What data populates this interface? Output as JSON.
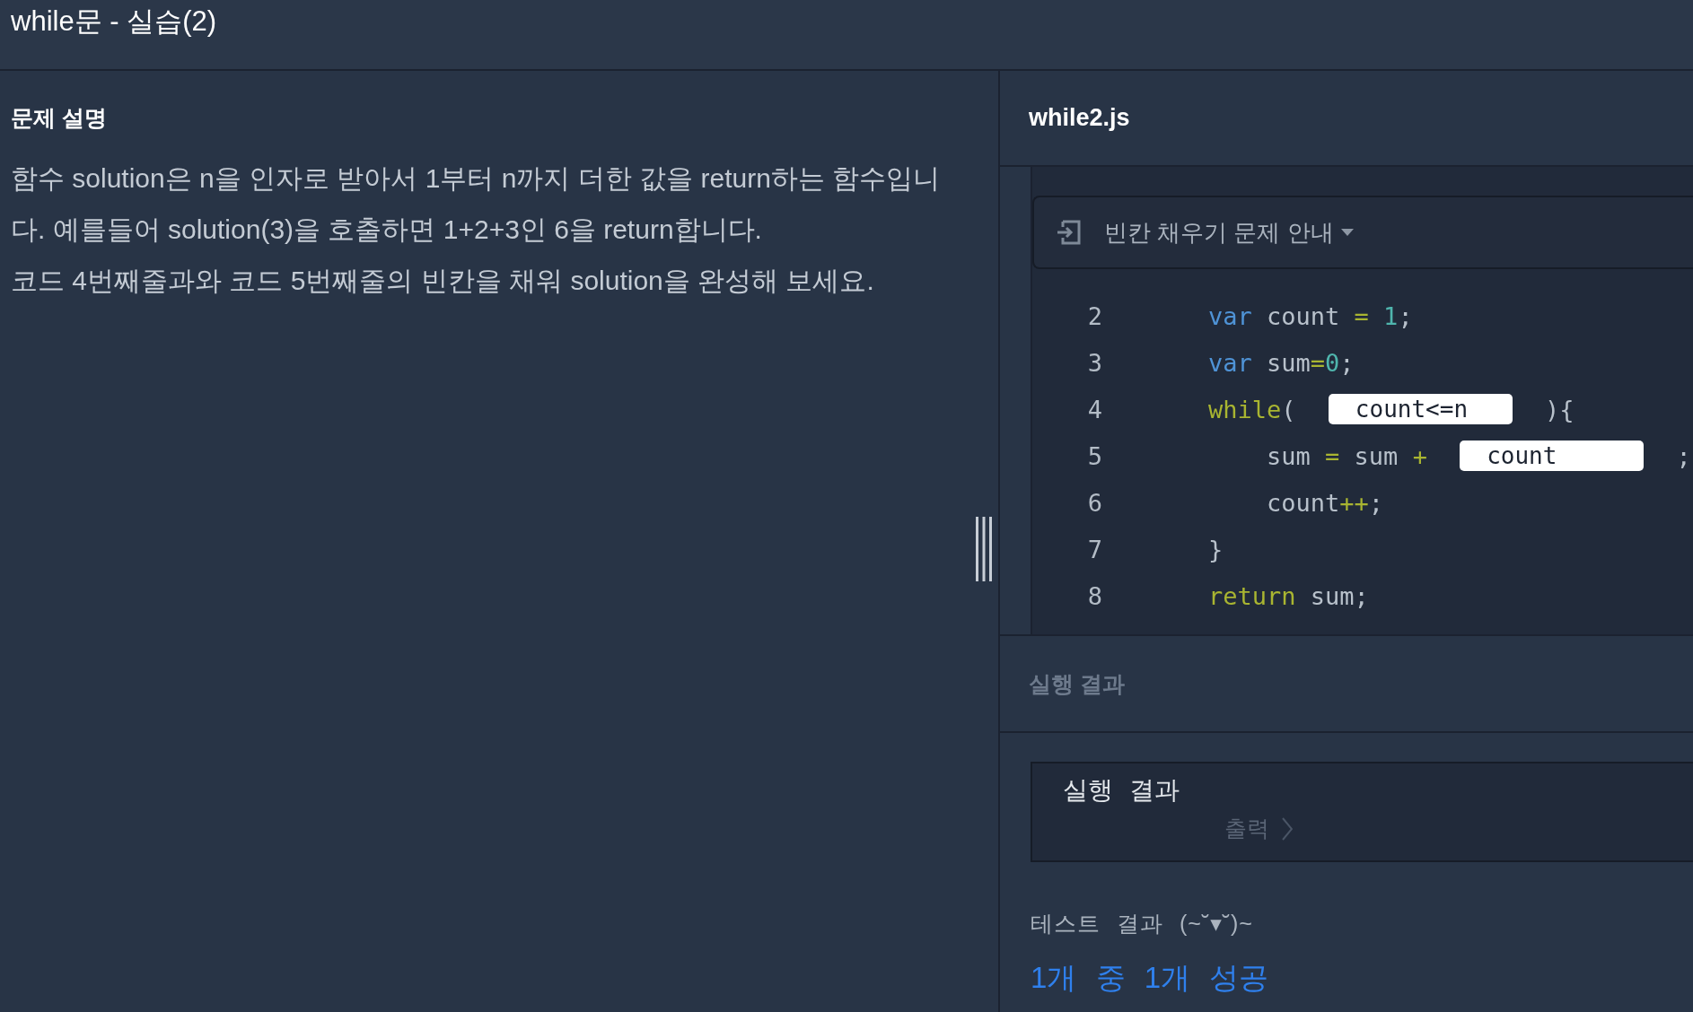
{
  "title": "while문 - 실습(2)",
  "problem": {
    "heading": "문제 설명",
    "paragraphs": [
      "함수 solution은 n을 인자로 받아서 1부터 n까지 더한 값을 return하는 함수입니다. 예를들어 solution(3)을 호출하면 1+2+3인 6을 return합니다.",
      "코드 4번째줄과와 코드 5번째줄의 빈칸을 채워 solution을 완성해 보세요."
    ]
  },
  "editor": {
    "filename": "while2.js",
    "guide": {
      "label": "빈칸 채우기 문제 안내"
    },
    "lines": [
      {
        "number": "2",
        "tokens": [
          {
            "kind": "keyword",
            "text": "    var"
          },
          {
            "kind": "plain",
            "text": " count "
          },
          {
            "kind": "operator",
            "text": "= "
          },
          {
            "kind": "number",
            "text": "1"
          },
          {
            "kind": "plain",
            "text": ";"
          }
        ]
      },
      {
        "number": "3",
        "tokens": [
          {
            "kind": "keyword",
            "text": "    var"
          },
          {
            "kind": "plain",
            "text": " sum"
          },
          {
            "kind": "operator",
            "text": "="
          },
          {
            "kind": "number",
            "text": "0"
          },
          {
            "kind": "plain",
            "text": ";"
          }
        ]
      },
      {
        "number": "4",
        "tokens": [
          {
            "kind": "control",
            "text": "    while"
          },
          {
            "kind": "plain",
            "text": "( "
          },
          {
            "kind": "blank",
            "value": "count<=n"
          },
          {
            "kind": "plain",
            "text": " ){"
          }
        ]
      },
      {
        "number": "5",
        "tokens": [
          {
            "kind": "plain",
            "text": "        sum "
          },
          {
            "kind": "operator",
            "text": "="
          },
          {
            "kind": "plain",
            "text": " sum "
          },
          {
            "kind": "operator",
            "text": "+ "
          },
          {
            "kind": "blank",
            "value": "count"
          },
          {
            "kind": "plain",
            "text": " ;"
          }
        ]
      },
      {
        "number": "6",
        "tokens": [
          {
            "kind": "plain",
            "text": "        count"
          },
          {
            "kind": "operator",
            "text": "++"
          },
          {
            "kind": "plain",
            "text": ";"
          }
        ]
      },
      {
        "number": "7",
        "tokens": [
          {
            "kind": "plain",
            "text": "    }"
          }
        ]
      },
      {
        "number": "8",
        "tokens": [
          {
            "kind": "control",
            "text": "    return"
          },
          {
            "kind": "plain",
            "text": " sum;"
          }
        ]
      }
    ]
  },
  "result": {
    "heading": "실행 결과",
    "console": {
      "label": "실행 결과",
      "output_label": "출력"
    },
    "test": {
      "label": "테스트 결과 (~˘▾˘)~",
      "summary": "1개 중 1개 성공"
    }
  }
}
